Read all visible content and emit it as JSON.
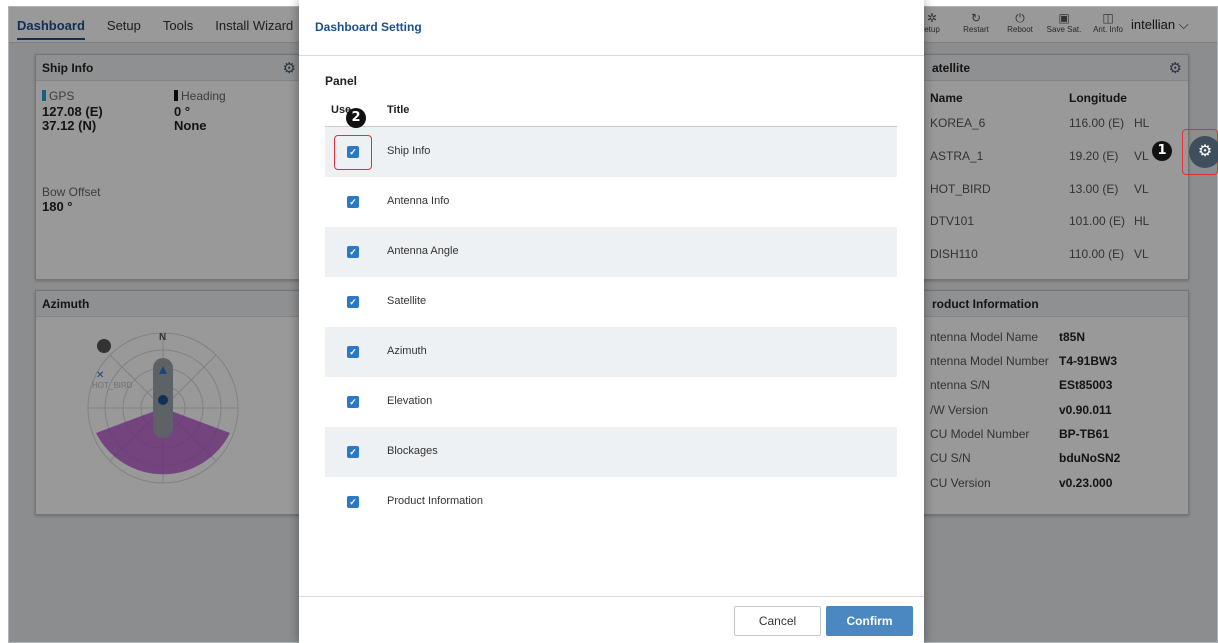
{
  "nav": {
    "items": [
      "Dashboard",
      "Setup",
      "Tools",
      "Install Wizard"
    ]
  },
  "toolbar": {
    "items": [
      {
        "icon": "gear-icon",
        "label": "etup"
      },
      {
        "icon": "restart-icon",
        "label": "Restart"
      },
      {
        "icon": "power-icon",
        "label": "Reboot"
      },
      {
        "icon": "save-icon",
        "label": "Save Sat."
      },
      {
        "icon": "antenna-info-icon",
        "label": "Ant. Info"
      }
    ]
  },
  "user": {
    "name": "intellian",
    "chevron": "chevron-down-icon"
  },
  "ship_info": {
    "title": "Ship Info",
    "gps_label": "GPS",
    "gps_lon": "127.08 (E)",
    "gps_lat": "37.12 (N)",
    "heading_label": "Heading",
    "heading_value": "0 °",
    "heading_source": "None",
    "bow_offset_label": "Bow Offset",
    "bow_offset_value": "180 °"
  },
  "azimuth": {
    "title": "Azimuth",
    "north": "N",
    "sat_label": "HOT_BIRD"
  },
  "satellite": {
    "title": "atellite",
    "col_name": "Name",
    "col_longitude": "Longitude",
    "rows": [
      {
        "name": "KOREA_6",
        "lon": "116.00 (E)",
        "pol": "HL"
      },
      {
        "name": "ASTRA_1",
        "lon": "19.20 (E)",
        "pol": "VL"
      },
      {
        "name": "HOT_BIRD",
        "lon": "13.00 (E)",
        "pol": "VL"
      },
      {
        "name": "DTV101",
        "lon": "101.00 (E)",
        "pol": "HL"
      },
      {
        "name": "DISH110",
        "lon": "110.00 (E)",
        "pol": "VL"
      }
    ]
  },
  "product_info": {
    "title": "roduct Information",
    "rows": [
      {
        "label": "ntenna Model Name",
        "value": "t85N"
      },
      {
        "label": "ntenna Model Number",
        "value": "T4-91BW3"
      },
      {
        "label": "ntenna S/N",
        "value": "ESt85003"
      },
      {
        "label": "/W Version",
        "value": "v0.90.011"
      },
      {
        "label": "CU Model Number",
        "value": "BP-TB61"
      },
      {
        "label": "CU S/N",
        "value": "bduNoSN2"
      },
      {
        "label": "CU Version",
        "value": "v0.23.000"
      }
    ]
  },
  "modal": {
    "title": "Dashboard Setting",
    "panel_label": "Panel",
    "col_use": "Use",
    "col_title": "Title",
    "rows": [
      "Ship Info",
      "Antenna Info",
      "Antenna Angle",
      "Satellite",
      "Azimuth",
      "Elevation",
      "Blockages",
      "Product Information"
    ],
    "cancel": "Cancel",
    "confirm": "Confirm"
  },
  "callouts": {
    "one": "1",
    "two": "2"
  },
  "colors": {
    "accent": "#1d4f8c",
    "checkbox": "#2a78c6",
    "confirm": "#4b87c0",
    "highlight": "#e1303a",
    "azimuth_sector": "#b04fc8"
  }
}
